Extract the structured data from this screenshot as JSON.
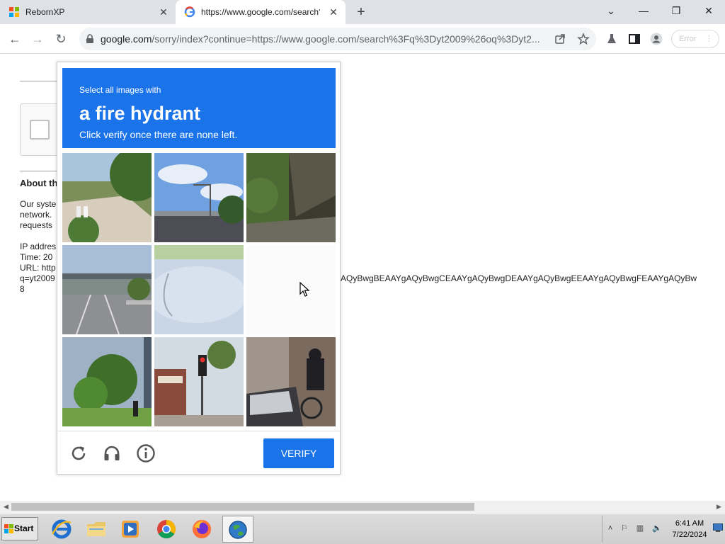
{
  "browser": {
    "tabs": [
      {
        "title": "RebornXP",
        "active": false
      },
      {
        "title": "https://www.google.com/search?q",
        "active": true
      }
    ],
    "new_tab_label": "+",
    "window_controls": {
      "dropdown": "⌄",
      "minimize": "—",
      "restore": "❐",
      "close": "✕"
    },
    "address": {
      "host": "google.com",
      "rest": "/sorry/index?continue=https://www.google.com/search%3Fq%3Dyt2009%26oq%3Dyt2..."
    },
    "update_button": "Error"
  },
  "page": {
    "about_heading": "About th",
    "para1": [
      "Our syste",
      "network.",
      "requests"
    ],
    "para2": [
      "IP addres",
      "Time: 20",
      "URL: http",
      "q=yt2009",
      "8"
    ],
    "url_tail": "AQyBwgBEAAYgAQyBwgCEAAYgAQyBwgDEAAYgAQyBwgEEAAYgAQyBwgFEAAYgAQyBw"
  },
  "captcha": {
    "instruction_small": "Select all images with",
    "target": "a fire hydrant",
    "instruction_hint": "Click verify once there are none left.",
    "verify_label": "VERIFY",
    "footer_icons": [
      "reload-icon",
      "headphones-icon",
      "info-icon"
    ]
  },
  "taskbar": {
    "start_label": "Start",
    "apps": [
      "internet-explorer",
      "file-explorer",
      "media-player",
      "chrome",
      "firefox",
      "network-globe"
    ],
    "clock_time": "6:41 AM",
    "clock_date": "7/22/2024"
  },
  "colors": {
    "accent": "#1a73e8",
    "tabstrip": "#dee1e6",
    "taskbar": "#d4d4d4"
  }
}
